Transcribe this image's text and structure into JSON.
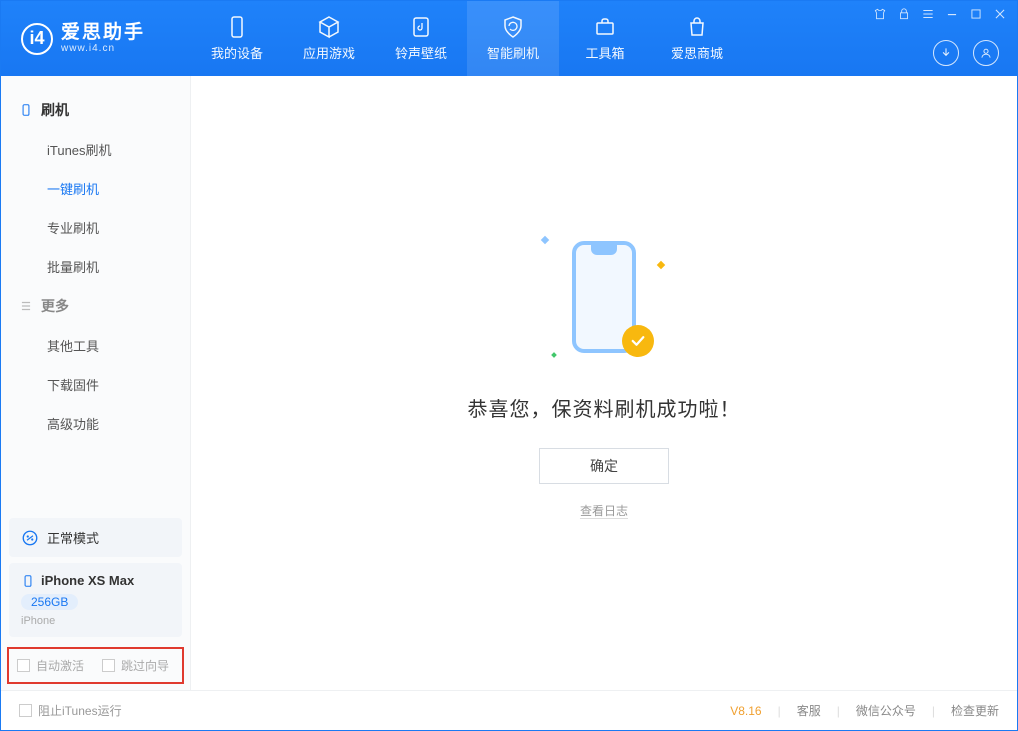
{
  "logo": {
    "title": "爱思助手",
    "subtitle": "www.i4.cn"
  },
  "tabs": {
    "device": "我的设备",
    "apps": "应用游戏",
    "ringtones": "铃声壁纸",
    "flash": "智能刷机",
    "toolbox": "工具箱",
    "store": "爱思商城"
  },
  "sidebar": {
    "group_flash": "刷机",
    "items_flash": {
      "itunes": "iTunes刷机",
      "oneclick": "一键刷机",
      "pro": "专业刷机",
      "batch": "批量刷机"
    },
    "group_more": "更多",
    "items_more": {
      "other": "其他工具",
      "firmware": "下载固件",
      "advanced": "高级功能"
    }
  },
  "mode_card": {
    "label": "正常模式"
  },
  "device_card": {
    "name": "iPhone XS Max",
    "storage": "256GB",
    "type": "iPhone"
  },
  "highlight": {
    "auto_activate": "自动激活",
    "skip_guide": "跳过向导"
  },
  "main": {
    "success": "恭喜您，保资料刷机成功啦！",
    "ok": "确定",
    "view_log": "查看日志"
  },
  "footer": {
    "block_itunes": "阻止iTunes运行",
    "version": "V8.16",
    "service": "客服",
    "wechat": "微信公众号",
    "update": "检查更新"
  }
}
